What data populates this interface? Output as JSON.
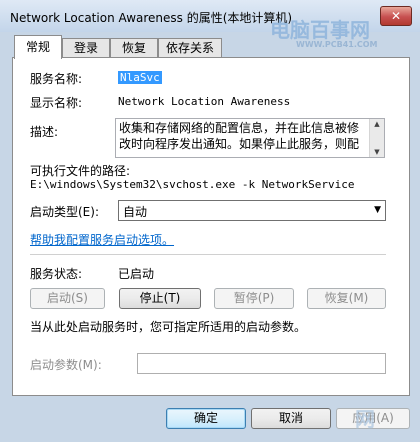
{
  "window": {
    "title": "Network Location Awareness 的属性(本地计算机)",
    "close_glyph": "✕"
  },
  "watermark": {
    "text": "电脑百事网",
    "url": "WWW.PCB41.COM",
    "corner_text": "网"
  },
  "tabs": [
    {
      "label": "常规",
      "active": true
    },
    {
      "label": "登录",
      "active": false
    },
    {
      "label": "恢复",
      "active": false
    },
    {
      "label": "依存关系",
      "active": false
    }
  ],
  "general": {
    "service_name_label": "服务名称:",
    "service_name_value": "NlaSvc",
    "display_name_label": "显示名称:",
    "display_name_value": "Network Location Awareness",
    "description_label": "描述:",
    "description_line1": "收集和存储网络的配置信息，并在此信息被修",
    "description_line2": "改时向程序发出通知。如果停止此服务，则配",
    "exe_path_label": "可执行文件的路径:",
    "exe_path_value": "E:\\windows\\System32\\svchost.exe -k NetworkService",
    "startup_type_label": "启动类型(E):",
    "startup_type_value": "自动",
    "help_link": "帮助我配置服务启动选项。",
    "service_status_label": "服务状态:",
    "service_status_value": "已启动",
    "start_button": "启动(S)",
    "stop_button": "停止(T)",
    "pause_button": "暂停(P)",
    "resume_button": "恢复(M)",
    "hint_text": "当从此处启动服务时，您可指定所适用的启动参数。",
    "start_params_label": "启动参数(M):",
    "start_params_value": ""
  },
  "footer": {
    "ok_button": "确定",
    "cancel_button": "取消",
    "apply_button": "应用(A)"
  }
}
